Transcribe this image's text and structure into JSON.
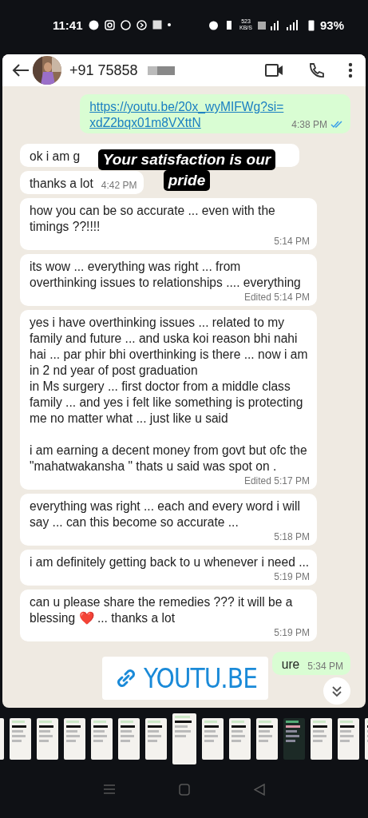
{
  "status_bar": {
    "time": "11:41",
    "speed": "523",
    "speed_unit": "KB/S",
    "battery": "93%"
  },
  "chat": {
    "contact": "+91 75858",
    "messages": [
      {
        "kind": "outgoing",
        "text": "https://youtu.be/20x_wyMIFWg?si=\nxdZ2bqx01m8VXttN",
        "link": true,
        "time": "4:38 PM",
        "read": true
      },
      {
        "kind": "incoming",
        "text": "ok i am g"
      },
      {
        "kind": "incoming",
        "text": "thanks a lot",
        "time": "4:42 PM"
      },
      {
        "kind": "incoming",
        "text": "how you can be so accurate ... even with the timings ??!!!!",
        "time": "5:14 PM"
      },
      {
        "kind": "incoming",
        "text": "its wow ... everything was right ... from overthinking issues to relationships .... everything",
        "time": "Edited 5:14 PM"
      },
      {
        "kind": "incoming",
        "text": "yes i have overthinking issues ... related to my family and future ... and uska koi reason bhi nahi hai ... par phir bhi overthinking is there ... now i am in 2 nd year of post graduation\nin Ms surgery ... first doctor from a middle class family ... and yes i felt like something is protecting me no matter what ... just like u said\n\ni am earning a decent money from govt but ofc the \"mahatwakansha \" thats u said was spot on .",
        "time": "Edited 5:17 PM"
      },
      {
        "kind": "incoming",
        "text": "everything was right ... each and every word i will say ... can this become so accurate ...",
        "time": "5:18 PM"
      },
      {
        "kind": "incoming",
        "text": "i am definitely getting back to u whenever i need ...",
        "time": "5:19 PM"
      },
      {
        "kind": "incoming",
        "text": "can u please share the remedies ??? it will be a blessing ❤️ ... thanks a lot",
        "time": "5:19 PM"
      },
      {
        "kind": "outgoing",
        "text": "ure",
        "time": "5:34 PM"
      }
    ]
  },
  "caption": [
    "Your satisfaction is our",
    "pride"
  ],
  "link_badge": "YOUTU.BE",
  "thumbnails": [
    {
      "selected": false,
      "dark": false
    },
    {
      "selected": false,
      "dark": false
    },
    {
      "selected": false,
      "dark": false
    },
    {
      "selected": false,
      "dark": false
    },
    {
      "selected": false,
      "dark": false
    },
    {
      "selected": false,
      "dark": false
    },
    {
      "selected": false,
      "dark": false
    },
    {
      "selected": true,
      "dark": false
    },
    {
      "selected": false,
      "dark": false
    },
    {
      "selected": false,
      "dark": false
    },
    {
      "selected": false,
      "dark": false
    },
    {
      "selected": false,
      "dark": true
    },
    {
      "selected": false,
      "dark": false
    },
    {
      "selected": false,
      "dark": false
    },
    {
      "selected": false,
      "dark": false
    }
  ]
}
